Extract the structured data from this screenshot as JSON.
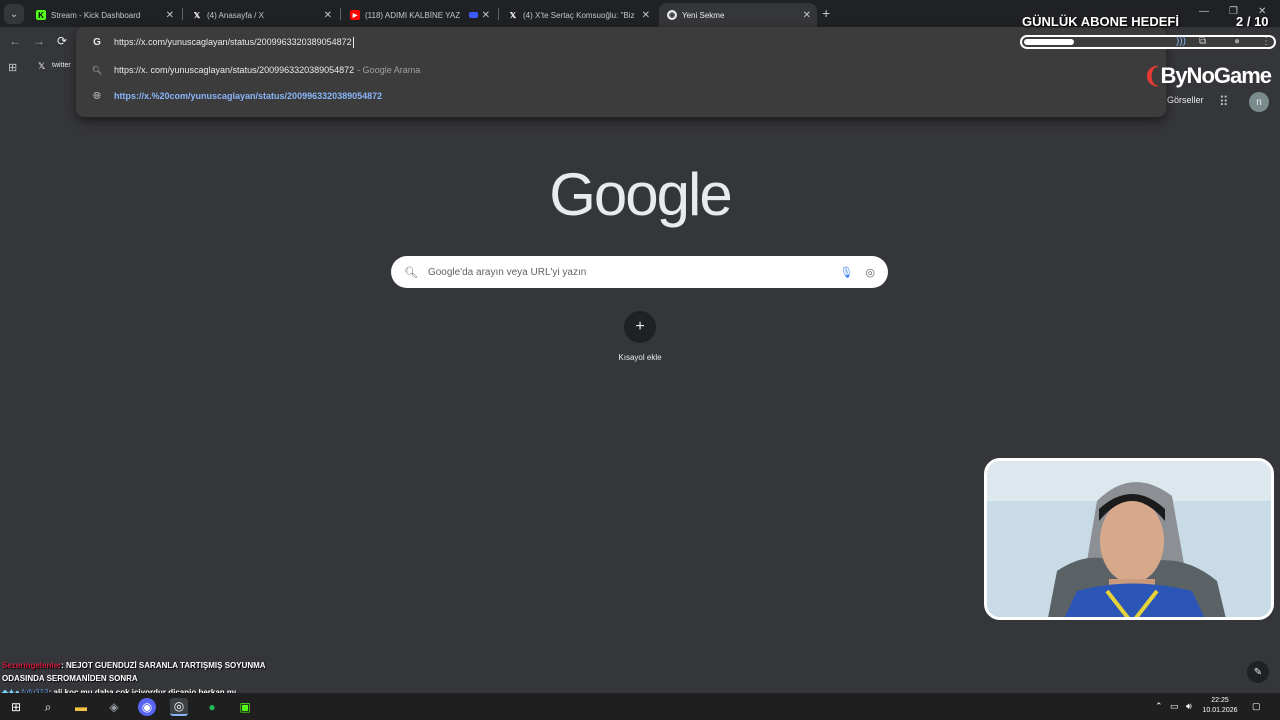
{
  "tabs": [
    {
      "title": "Stream - Kick Dashboard",
      "favicon": "kick-icon",
      "color": "#53fc18"
    },
    {
      "title": "(4) Anasayfa / X",
      "favicon": "x-icon",
      "color": "#ffffff"
    },
    {
      "title": "(118) ADIMI KALBİNE YAZ",
      "favicon": "youtube-icon",
      "color": "#ff0000"
    },
    {
      "title": "(4) X'te Sertaç Komsuoğlu: \"Biz",
      "favicon": "x-icon",
      "color": "#ffffff"
    },
    {
      "title": "Yeni Sekme",
      "favicon": "chrome-icon",
      "color": "#ffffff"
    }
  ],
  "omnibox": {
    "input_value_a": "https://x.",
    "input_value_b": "com/yunuscaglayan/status/2009963320389054872",
    "suggestion_text": "https://x. com/yunuscaglayan/status/2009963320389054872",
    "suggestion_source": "- Google Arama",
    "url_suggestion": "https://x.%20com/yunuscaglayan/status/2009963320389054872"
  },
  "bookmarks": [
    {
      "label": "twitter"
    }
  ],
  "ntp": {
    "images_link": "Görseller",
    "avatar_letter": "n",
    "logo": "Google",
    "search_placeholder": "Google'da arayın veya URL'yi yazın",
    "shortcut_label": "Kısayol ekle"
  },
  "overlay": {
    "goal_title": "GÜNLÜK ABONE HEDEFİ",
    "goal_count": "2 / 10",
    "goal_progress": 0.2,
    "brand": "ByNoGame"
  },
  "chat": [
    {
      "user": "Sezeringelenler",
      "message": ": NEJOT GUENDUZİ SARANLA TARTIŞMIŞ SOYUNMA"
    },
    {
      "user": "",
      "message": "ODASINDA SEROMANİDEN SONRA"
    },
    {
      "user": "fufu312",
      "message": ": ali koç mu daha çok içiyordur dicanio berkan mı"
    }
  ],
  "taskbar": {
    "time": "22:25",
    "date": "10.01.2026"
  }
}
